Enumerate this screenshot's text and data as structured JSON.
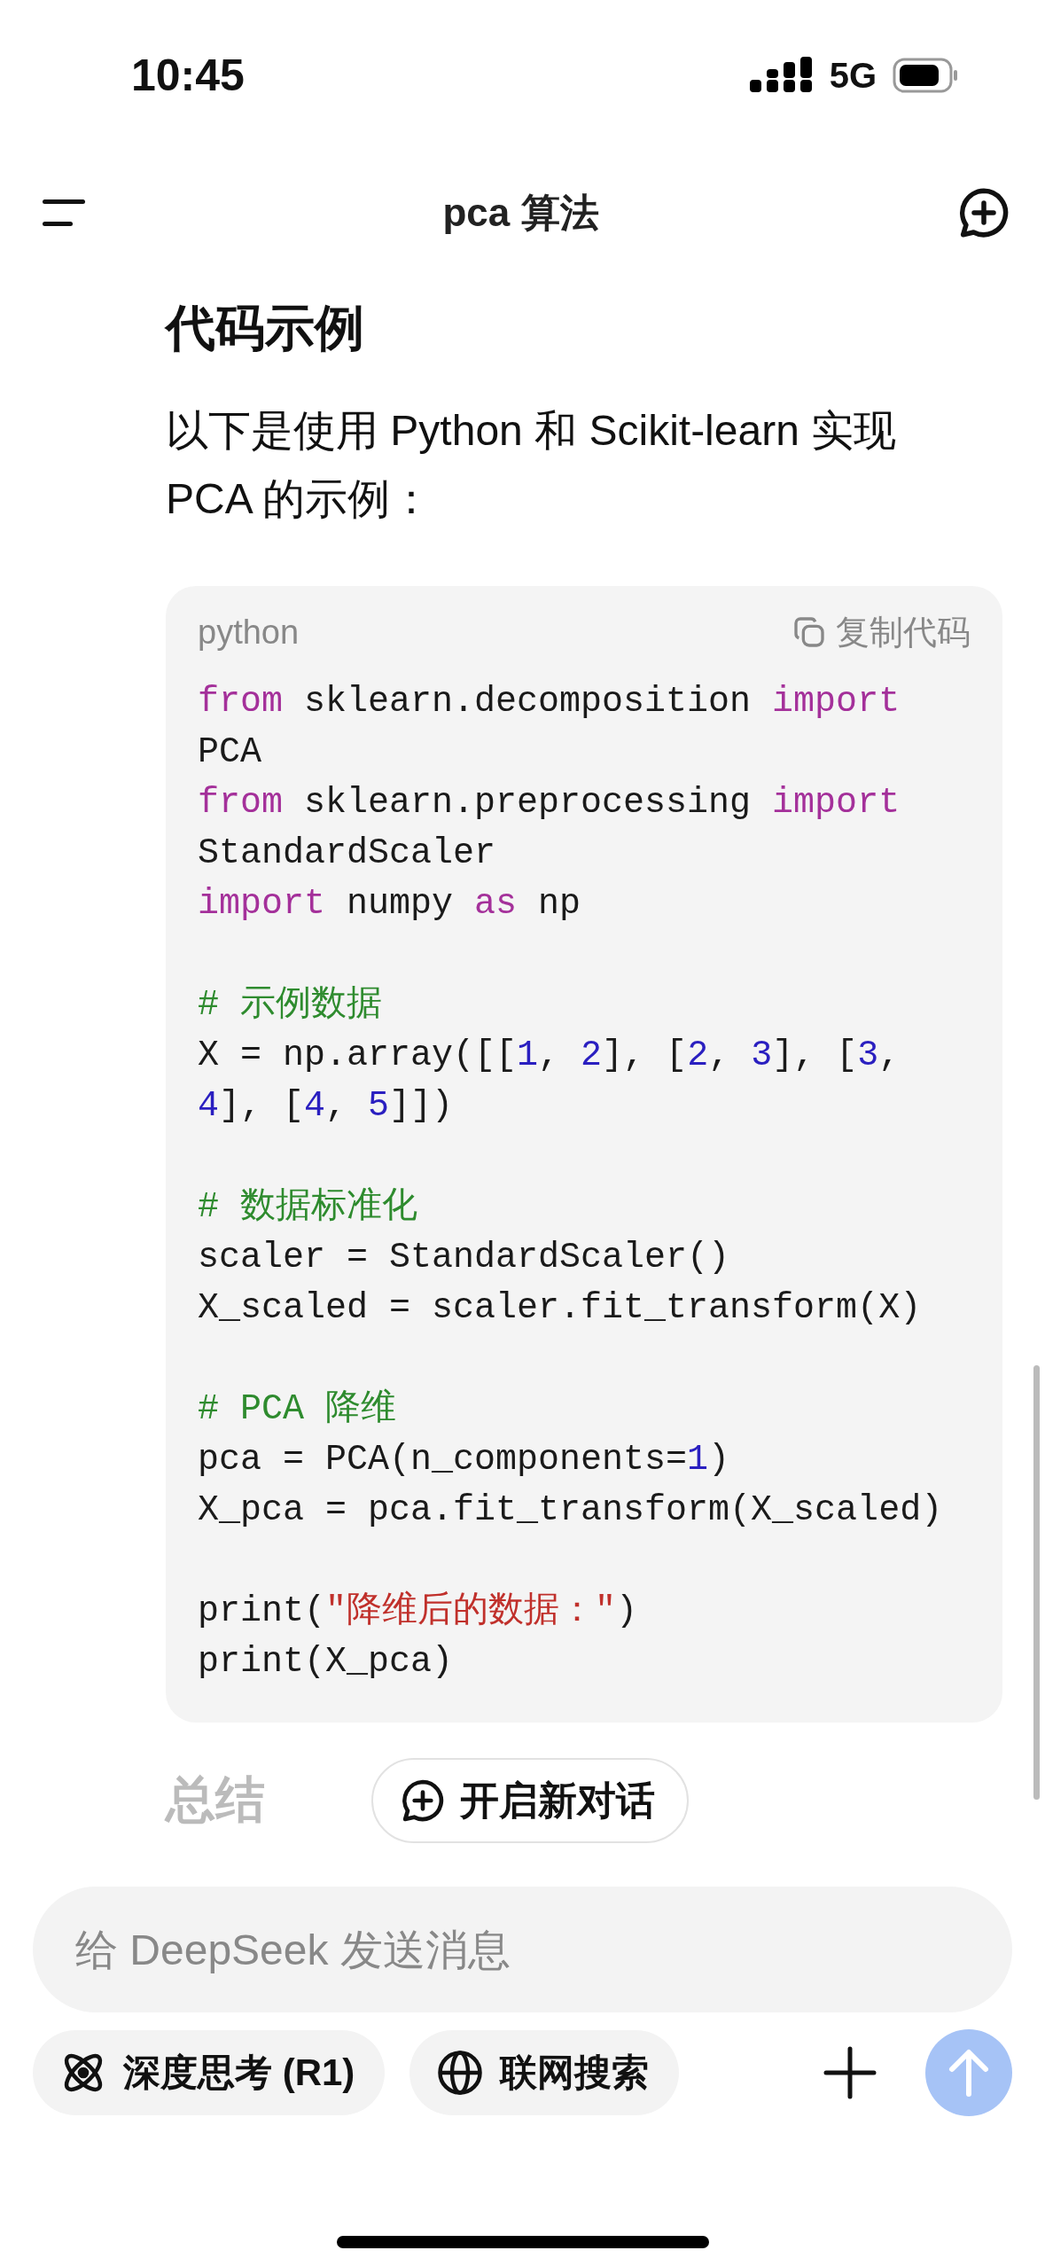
{
  "status_bar": {
    "time": "10:45",
    "network": "5G"
  },
  "header": {
    "title": "pca 算法"
  },
  "message": {
    "heading": "代码示例",
    "paragraph": "以下是使用 Python 和 Scikit-learn 实现 PCA 的示例：",
    "code_block": {
      "language": "python",
      "copy_label": "复制代码",
      "lines": [
        {
          "kind": "code",
          "tokens": [
            {
              "kind": "keyword",
              "text": "from"
            },
            {
              "kind": "plain",
              "text": " sklearn.decomposition "
            },
            {
              "kind": "keyword",
              "text": "import"
            }
          ]
        },
        {
          "kind": "code",
          "tokens": [
            {
              "kind": "plain",
              "text": "PCA"
            }
          ]
        },
        {
          "kind": "code",
          "tokens": [
            {
              "kind": "keyword",
              "text": "from"
            },
            {
              "kind": "plain",
              "text": " sklearn.preprocessing "
            },
            {
              "kind": "keyword",
              "text": "import"
            }
          ]
        },
        {
          "kind": "code",
          "tokens": [
            {
              "kind": "plain",
              "text": "StandardScaler"
            }
          ]
        },
        {
          "kind": "code",
          "tokens": [
            {
              "kind": "keyword",
              "text": "import"
            },
            {
              "kind": "plain",
              "text": " numpy "
            },
            {
              "kind": "keyword",
              "text": "as"
            },
            {
              "kind": "plain",
              "text": " np"
            }
          ]
        },
        {
          "kind": "blank"
        },
        {
          "kind": "code",
          "tokens": [
            {
              "kind": "comment",
              "text": "# 示例数据"
            }
          ]
        },
        {
          "kind": "code",
          "tokens": [
            {
              "kind": "plain",
              "text": "X = np.array([["
            },
            {
              "kind": "number",
              "text": "1"
            },
            {
              "kind": "plain",
              "text": ", "
            },
            {
              "kind": "number",
              "text": "2"
            },
            {
              "kind": "plain",
              "text": "], ["
            },
            {
              "kind": "number",
              "text": "2"
            },
            {
              "kind": "plain",
              "text": ", "
            },
            {
              "kind": "number",
              "text": "3"
            },
            {
              "kind": "plain",
              "text": "], ["
            },
            {
              "kind": "number",
              "text": "3"
            },
            {
              "kind": "plain",
              "text": ","
            }
          ]
        },
        {
          "kind": "code",
          "tokens": [
            {
              "kind": "number",
              "text": "4"
            },
            {
              "kind": "plain",
              "text": "], ["
            },
            {
              "kind": "number",
              "text": "4"
            },
            {
              "kind": "plain",
              "text": ", "
            },
            {
              "kind": "number",
              "text": "5"
            },
            {
              "kind": "plain",
              "text": "]])"
            }
          ]
        },
        {
          "kind": "blank"
        },
        {
          "kind": "code",
          "tokens": [
            {
              "kind": "comment",
              "text": "# 数据标准化"
            }
          ]
        },
        {
          "kind": "code",
          "tokens": [
            {
              "kind": "plain",
              "text": "scaler = StandardScaler()"
            }
          ]
        },
        {
          "kind": "code",
          "tokens": [
            {
              "kind": "plain",
              "text": "X_scaled = scaler.fit_transform(X)"
            }
          ]
        },
        {
          "kind": "blank"
        },
        {
          "kind": "code",
          "tokens": [
            {
              "kind": "comment",
              "text": "# PCA 降维"
            }
          ]
        },
        {
          "kind": "code",
          "tokens": [
            {
              "kind": "plain",
              "text": "pca = PCA(n_components="
            },
            {
              "kind": "number",
              "text": "1"
            },
            {
              "kind": "plain",
              "text": ")"
            }
          ]
        },
        {
          "kind": "code",
          "tokens": [
            {
              "kind": "plain",
              "text": "X_pca = pca.fit_transform(X_scaled)"
            }
          ]
        },
        {
          "kind": "blank"
        },
        {
          "kind": "code",
          "tokens": [
            {
              "kind": "plain",
              "text": "print("
            },
            {
              "kind": "string",
              "text": "\"降维后的数据：\""
            },
            {
              "kind": "plain",
              "text": ")"
            }
          ]
        },
        {
          "kind": "code",
          "tokens": [
            {
              "kind": "plain",
              "text": "print(X_pca)"
            }
          ]
        }
      ]
    },
    "faded_heading": "总结"
  },
  "new_chat_button": {
    "label": "开启新对话"
  },
  "composer": {
    "placeholder": "给 DeepSeek 发送消息",
    "chips": [
      {
        "kind": "deep_think",
        "label": "深度思考 (R1)"
      },
      {
        "kind": "web_search",
        "label": "联网搜索"
      }
    ]
  }
}
